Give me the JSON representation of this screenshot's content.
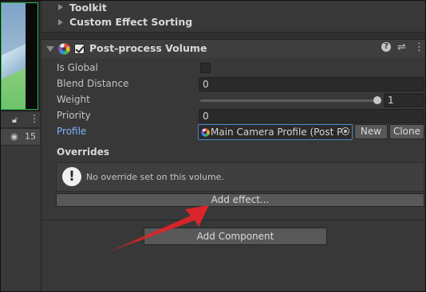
{
  "hierarchy": {
    "visibility_count": "15"
  },
  "inspector": {
    "toolkit_label": "Toolkit",
    "custom_sorting_label": "Custom Effect Sorting",
    "component_title": "Post-process Volume",
    "fields": {
      "is_global_label": "Is Global",
      "blend_distance_label": "Blend Distance",
      "blend_distance_value": "0",
      "weight_label": "Weight",
      "weight_value": "1",
      "weight_fraction": 1,
      "priority_label": "Priority",
      "priority_value": "0",
      "profile_label": "Profile",
      "profile_value": "Main Camera Profile (Post P",
      "new_label": "New",
      "clone_label": "Clone"
    },
    "overrides": {
      "title": "Overrides",
      "empty_message": "No override set on this volume.",
      "add_effect_label": "Add effect..."
    },
    "add_component_label": "Add Component"
  },
  "colors": {
    "accent_link": "#7fb4ff",
    "arrow_red": "#e0242a",
    "scene_border": "#2db84b"
  }
}
